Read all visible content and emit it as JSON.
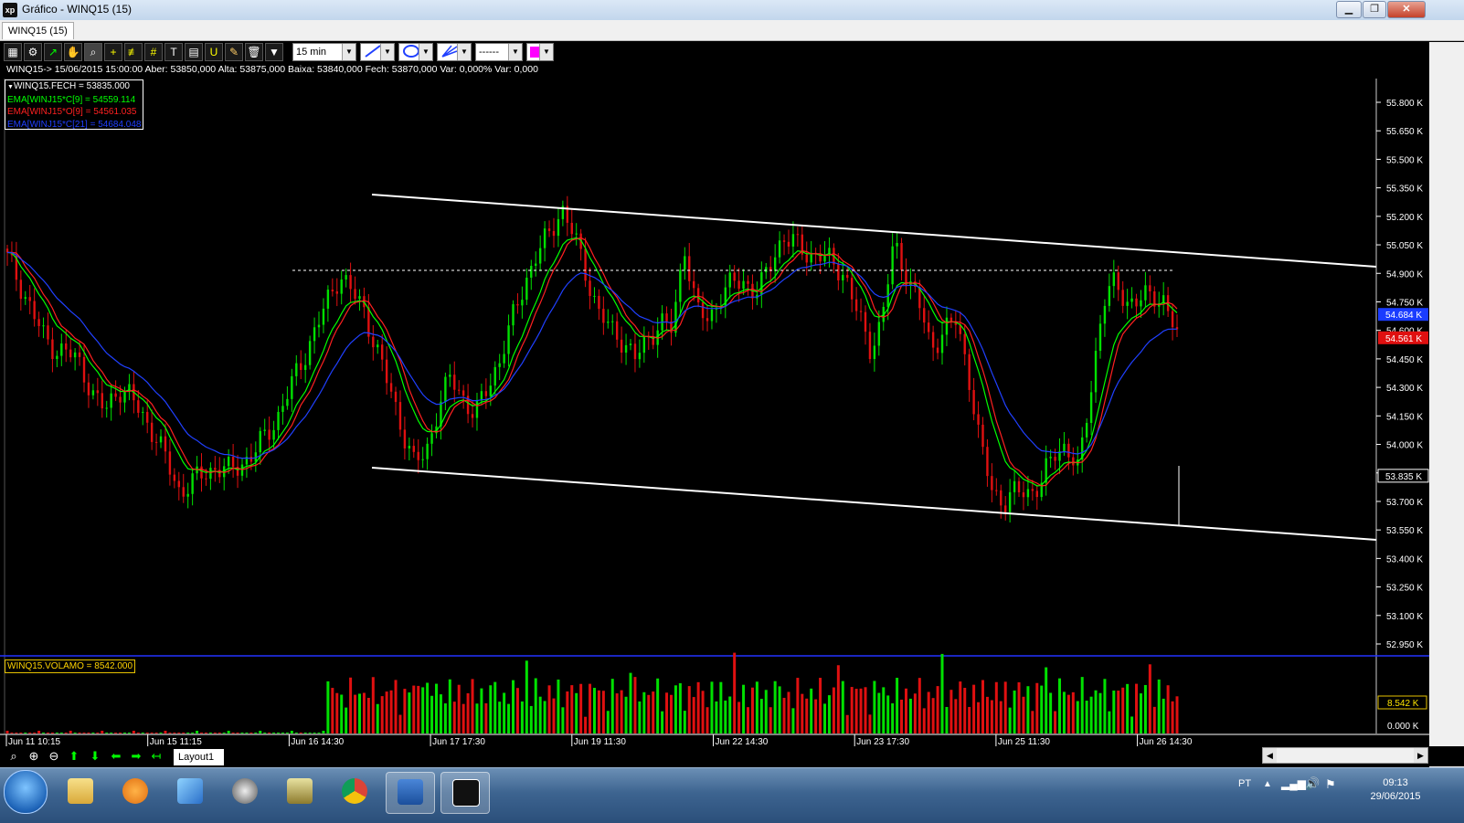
{
  "window": {
    "title": "Gráfico - WINQ15 (15)",
    "app_logo": "xp",
    "buttons": [
      "minimize-icon",
      "maximize-icon",
      "close-icon"
    ]
  },
  "tab": {
    "label": "WINQ15 (15)"
  },
  "toolbar": {
    "timeframe": "15 min",
    "line_style": "------",
    "icons": [
      "chart-icon",
      "gear-icon",
      "indicator-icon",
      "hand-icon",
      "zoom-icon",
      "crosshair-icon",
      "hline-icon",
      "grid-icon",
      "text-icon",
      "calculator-icon",
      "u-icon",
      "brush-icon",
      "trash-icon",
      "filter-icon"
    ],
    "colors": {
      "draw_color": "#ff00ff"
    }
  },
  "info_line": "WINQ15-> 15/06/2015 15:00:00 Aber: 53850,000 Alta: 53875,000 Baixa: 53840,000 Fech: 53870,000 Var: 0,000% Var: 0,000",
  "legend": [
    {
      "text": "WINQ15.FECH = 53835.000",
      "color": "#ffffff"
    },
    {
      "text": "EMA[WINJ15*C[9] = 54559.114",
      "color": "#00ff00"
    },
    {
      "text": "EMA[WINJ15*O[9] = 54561.035",
      "color": "#ff2020"
    },
    {
      "text": "EMA[WINJ15*C[21] = 54684.048",
      "color": "#2040ff"
    }
  ],
  "volume_label": "WINQ15.VOLAMO = 8542.000",
  "bottom": {
    "layout_tab": "Layout1"
  },
  "taskbar": {
    "tray_lang": "PT",
    "time": "09:13",
    "date": "29/06/2015"
  },
  "chart_data": {
    "type": "candlestick",
    "title": "",
    "y_axis_labels": [
      "55.800 K",
      "55.650 K",
      "55.500 K",
      "55.350 K",
      "55.200 K",
      "55.050 K",
      "54.900 K",
      "54.750 K",
      "54.600 K",
      "54.450 K",
      "54.300 K",
      "54.150 K",
      "54.000 K",
      "53.850 K",
      "53.700 K",
      "53.550 K",
      "53.400 K",
      "53.250 K",
      "53.100 K",
      "52.950 K"
    ],
    "y_markers": [
      {
        "label": "54.684 K",
        "color": "#1a3cff"
      },
      {
        "label": "54.561 K",
        "color": "#e01010"
      },
      {
        "label": "53.835 K",
        "color": "#ffffff"
      }
    ],
    "x_axis_labels": [
      "Jun 11 10:15",
      "Jun 15 11:15",
      "Jun 16 14:30",
      "Jun 17 17:30",
      "Jun 19 11:30",
      "Jun 22 14:30",
      "Jun 23 17:30",
      "Jun 25 11:30",
      "Jun 26 14:30"
    ],
    "volume_axis_labels": [
      "8.542 K",
      "0.000 K"
    ],
    "close_series": [
      54980,
      54850,
      54700,
      54560,
      54500,
      54480,
      54420,
      54250,
      54180,
      54300,
      54250,
      54150,
      54050,
      53900,
      53750,
      53800,
      53850,
      53880,
      53860,
      53900,
      53950,
      54050,
      54150,
      54300,
      54450,
      54600,
      54750,
      54900,
      54800,
      54700,
      54500,
      54300,
      54100,
      53900,
      53950,
      54200,
      54350,
      54250,
      54150,
      54300,
      54450,
      54650,
      54850,
      55000,
      55100,
      55250,
      55100,
      54900,
      54700,
      54600,
      54550,
      54450,
      54550,
      54650,
      54600,
      55050,
      54700,
      54650,
      54800,
      54850,
      54850,
      54800,
      54950,
      55100,
      55050,
      55000,
      55000,
      54950,
      54900,
      54700,
      54500,
      54650,
      55050,
      54900,
      54750,
      54500,
      54600,
      54650,
      54400,
      54000,
      53750,
      53700,
      53750,
      53750,
      53800,
      53950,
      54000,
      53850,
      54300,
      54750,
      54850,
      54750,
      54750,
      54800,
      54750,
      54561
    ]
  }
}
